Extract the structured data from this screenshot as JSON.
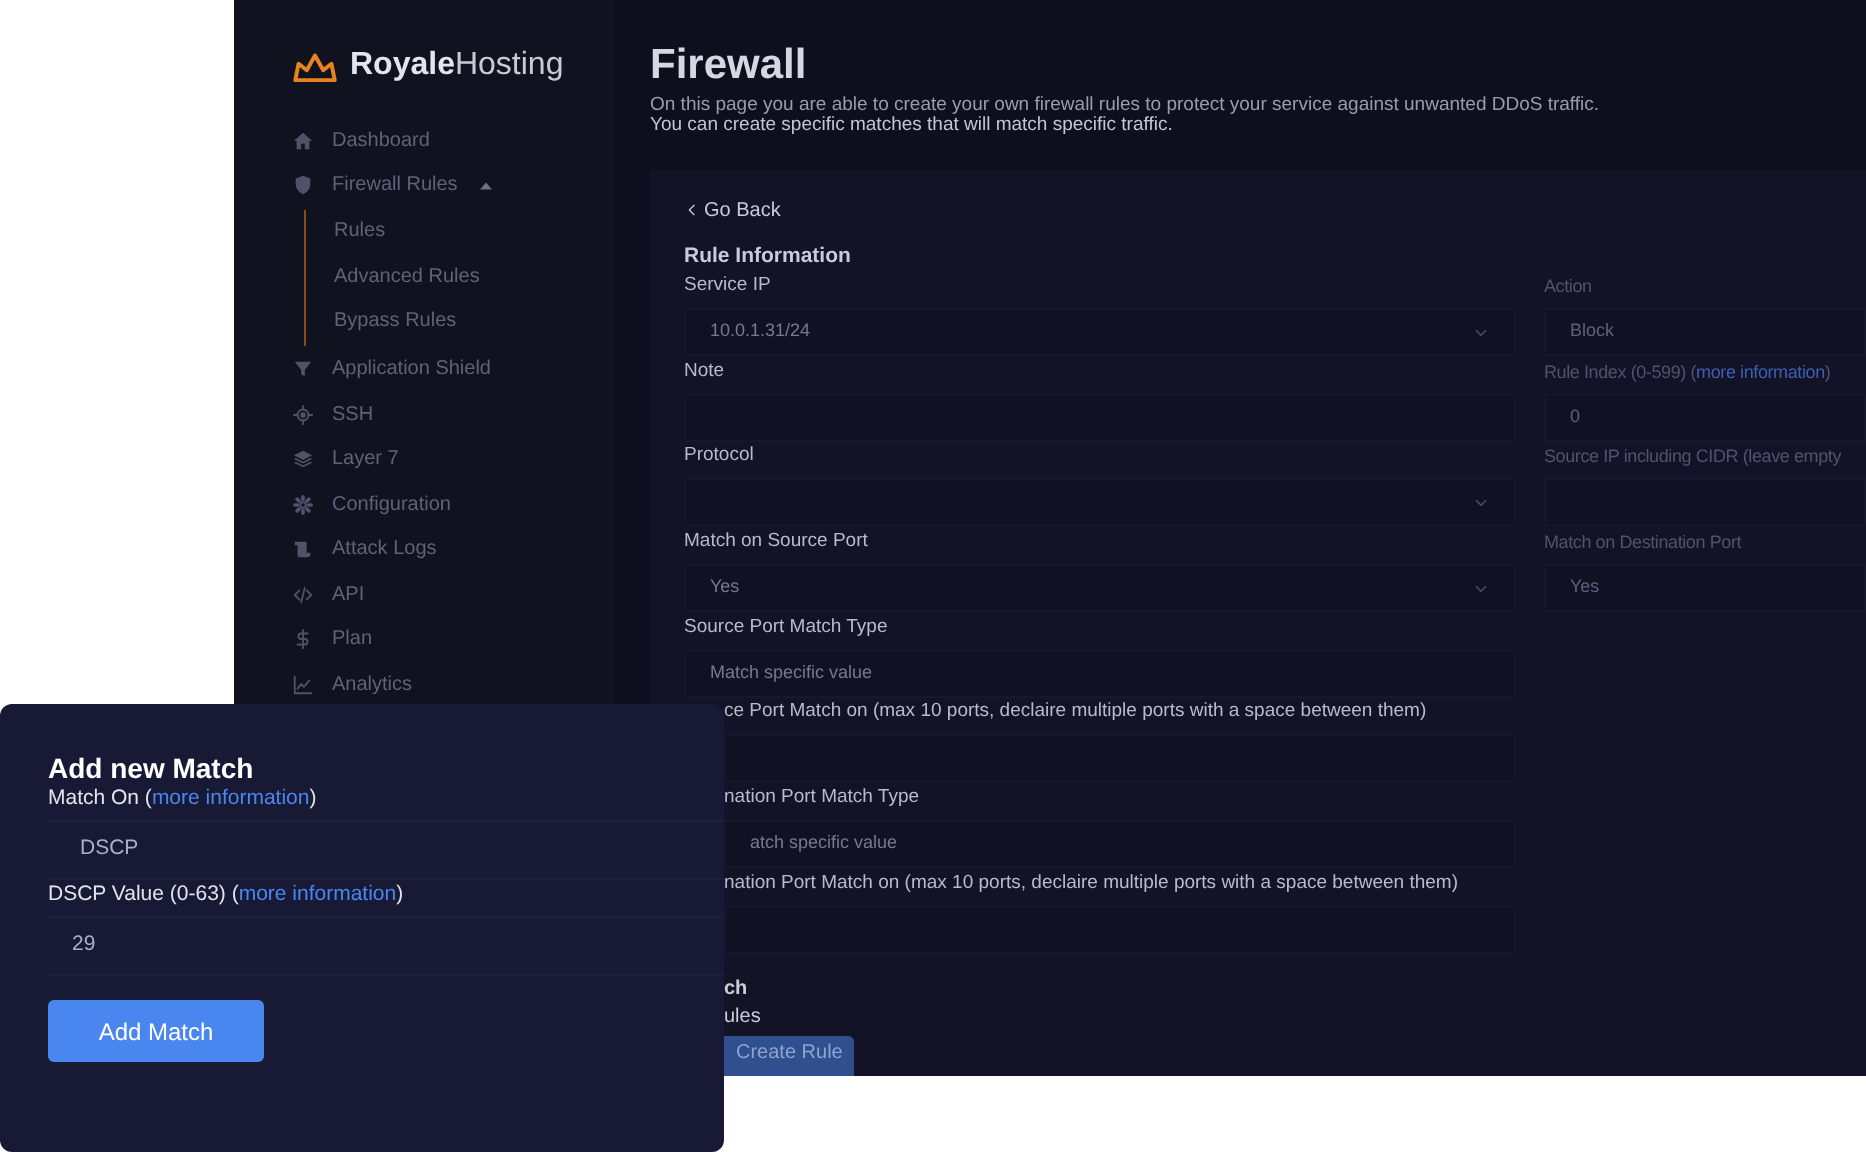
{
  "brand": {
    "strong": "Royale",
    "light": "Hosting"
  },
  "sidebar": {
    "items": [
      {
        "label": "Dashboard"
      },
      {
        "label": "Firewall Rules",
        "expanded": true,
        "children": [
          {
            "label": "Rules"
          },
          {
            "label": "Advanced Rules"
          },
          {
            "label": "Bypass Rules"
          }
        ]
      },
      {
        "label": "Application Shield"
      },
      {
        "label": "SSH"
      },
      {
        "label": "Layer 7"
      },
      {
        "label": "Configuration"
      },
      {
        "label": "Attack Logs"
      },
      {
        "label": "API"
      },
      {
        "label": "Plan"
      },
      {
        "label": "Analytics"
      }
    ]
  },
  "page": {
    "title": "Firewall",
    "description": [
      "On this page you are able to create your own firewall rules to protect your service against unwanted DDoS traffic.",
      "You can create specific matches that will match specific traffic."
    ]
  },
  "form": {
    "back_link": "Go Back",
    "section_title": "Rule Information",
    "left_fields": [
      {
        "kind": "select",
        "label": "Service IP",
        "value": "10.0.1.31/24"
      },
      {
        "kind": "input",
        "label": "Note"
      },
      {
        "kind": "select",
        "label": "Protocol"
      },
      {
        "kind": "select",
        "label": "Match on Source Port",
        "value": "Yes"
      },
      {
        "kind": "input",
        "label": "Source Port Match Type",
        "value": "Match specific value"
      },
      {
        "kind": "input",
        "label": "ce Port Match on (max 10 ports, declaire multiple ports with a space between them)"
      },
      {
        "kind": "input",
        "label": "nation Port Match Type",
        "value": "atch specific value"
      },
      {
        "kind": "input",
        "label": "nation Port Match on (max 10 ports, declaire multiple ports with a space between them)"
      }
    ],
    "right_fields": [
      {
        "kind": "input",
        "label": "Action",
        "value": "Block"
      },
      {
        "kind": "input",
        "label": "Rule Index (0-599) (",
        "link": "more information",
        "after": ")",
        "value": "0"
      },
      {
        "kind": "input",
        "label": "Source IP including CIDR (leave empty"
      },
      {
        "kind": "input",
        "label": "Match on Destination Port",
        "value": "Yes"
      }
    ],
    "subheading": "ch",
    "subtext": "ules",
    "submit": "Create Rule"
  },
  "match_dialog": {
    "title": "Add new Match",
    "fields": [
      {
        "label": "Match On (",
        "link": "more information",
        "after": ")",
        "value": "DSCP"
      },
      {
        "label": "DSCP Value (0-63) (",
        "link": "more information",
        "after": ")",
        "value": "29"
      }
    ],
    "button": "Add Match"
  }
}
